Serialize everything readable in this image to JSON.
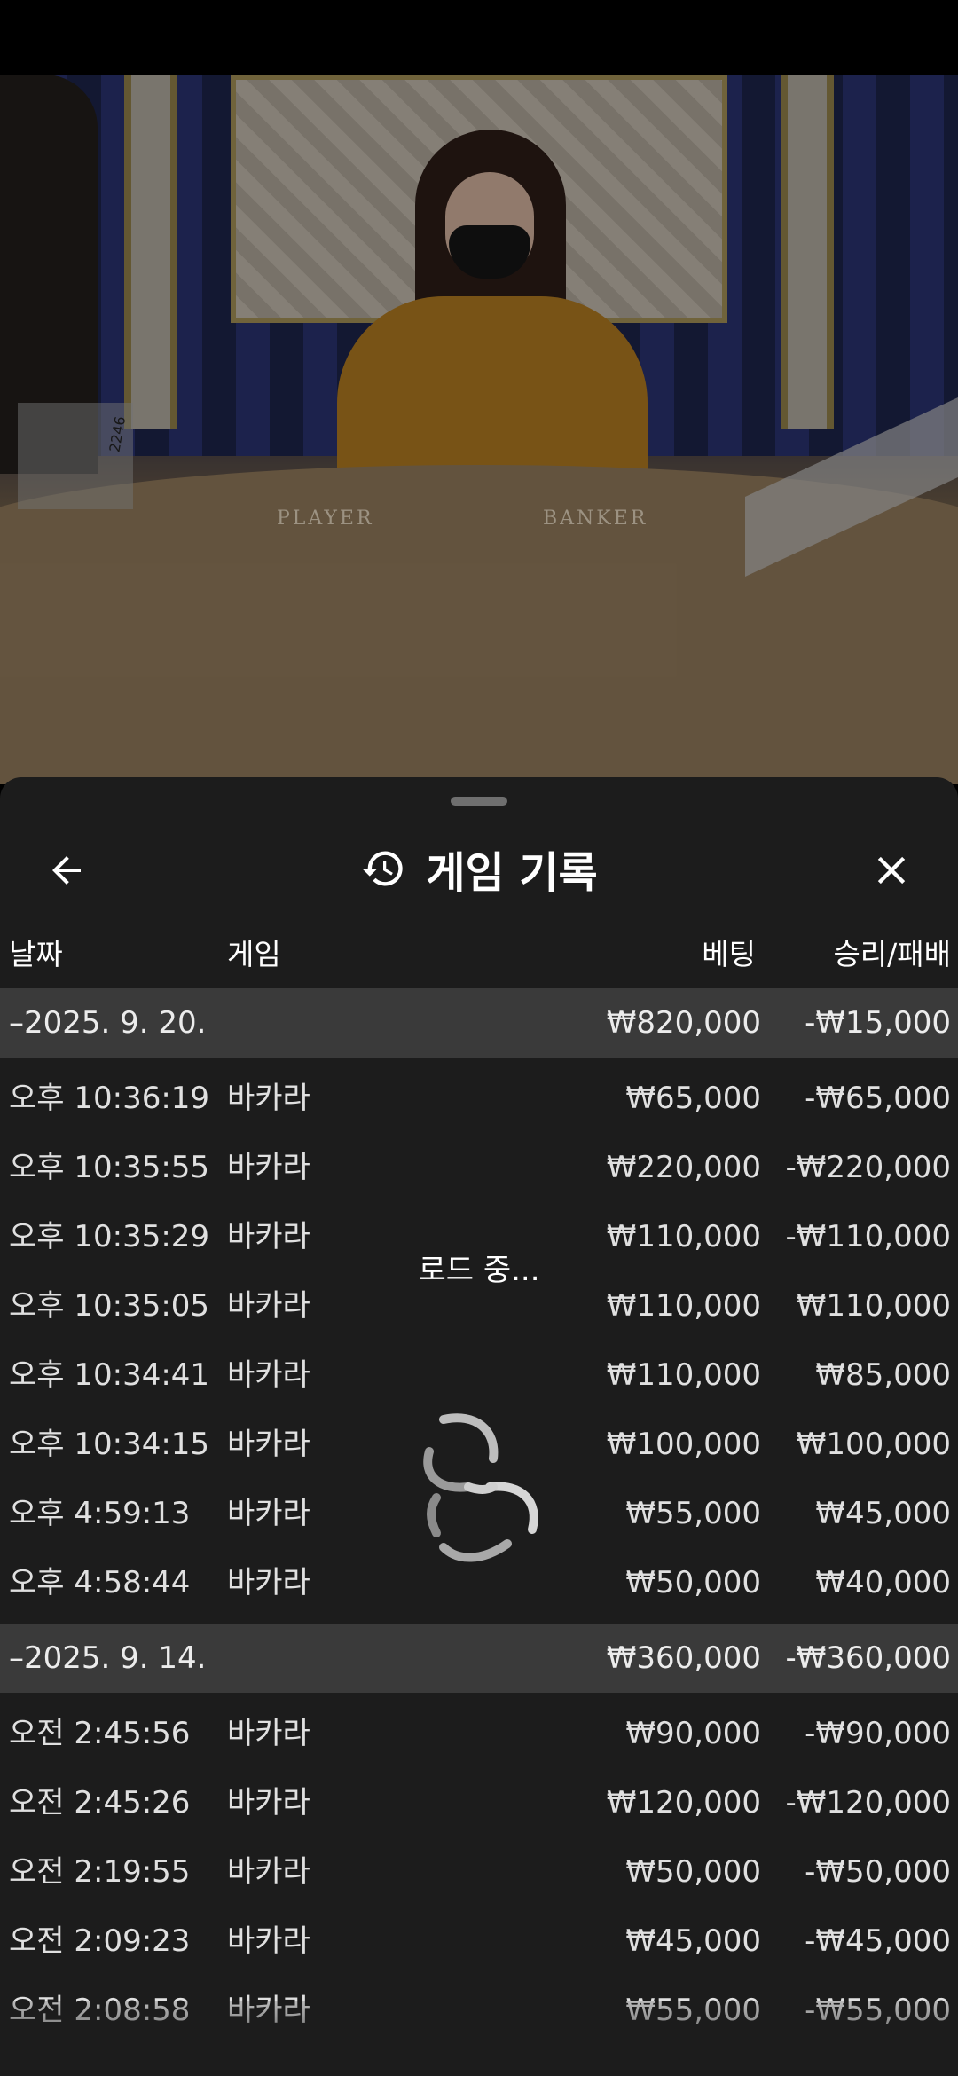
{
  "video": {
    "table_labels": [
      "PLAYER",
      "BANKER"
    ],
    "discard_counter": "2246"
  },
  "sheet": {
    "title": "게임 기록",
    "icons": {
      "back": "arrow-left-icon",
      "history": "history-icon",
      "close": "close-icon",
      "loader": "spinner-icon"
    },
    "columns": {
      "date": "날짜",
      "game": "게임",
      "bet": "베팅",
      "result": "승리/패배"
    },
    "loading_text": "로드 중...",
    "groups": [
      {
        "date": "–2025. 9. 20.",
        "bet_total": "₩820,000",
        "result_total": "-₩15,000",
        "rows": [
          {
            "time": "오후 10:36:19",
            "game": "바카라",
            "bet": "₩65,000",
            "result": "-₩65,000"
          },
          {
            "time": "오후 10:35:55",
            "game": "바카라",
            "bet": "₩220,000",
            "result": "-₩220,000"
          },
          {
            "time": "오후 10:35:29",
            "game": "바카라",
            "bet": "₩110,000",
            "result": "-₩110,000"
          },
          {
            "time": "오후 10:35:05",
            "game": "바카라",
            "bet": "₩110,000",
            "result": "₩110,000"
          },
          {
            "time": "오후 10:34:41",
            "game": "바카라",
            "bet": "₩110,000",
            "result": "₩85,000"
          },
          {
            "time": "오후 10:34:15",
            "game": "바카라",
            "bet": "₩100,000",
            "result": "₩100,000"
          },
          {
            "time": "오후 4:59:13",
            "game": "바카라",
            "bet": "₩55,000",
            "result": "₩45,000"
          },
          {
            "time": "오후 4:58:44",
            "game": "바카라",
            "bet": "₩50,000",
            "result": "₩40,000"
          }
        ]
      },
      {
        "date": "–2025. 9. 14.",
        "bet_total": "₩360,000",
        "result_total": "-₩360,000",
        "rows": [
          {
            "time": "오전 2:45:56",
            "game": "바카라",
            "bet": "₩90,000",
            "result": "-₩90,000"
          },
          {
            "time": "오전 2:45:26",
            "game": "바카라",
            "bet": "₩120,000",
            "result": "-₩120,000"
          },
          {
            "time": "오전 2:19:55",
            "game": "바카라",
            "bet": "₩50,000",
            "result": "-₩50,000"
          },
          {
            "time": "오전 2:09:23",
            "game": "바카라",
            "bet": "₩45,000",
            "result": "-₩45,000"
          },
          {
            "time": "오전 2:08:58",
            "game": "바카라",
            "bet": "₩55,000",
            "result": "-₩55,000"
          }
        ]
      }
    ]
  }
}
